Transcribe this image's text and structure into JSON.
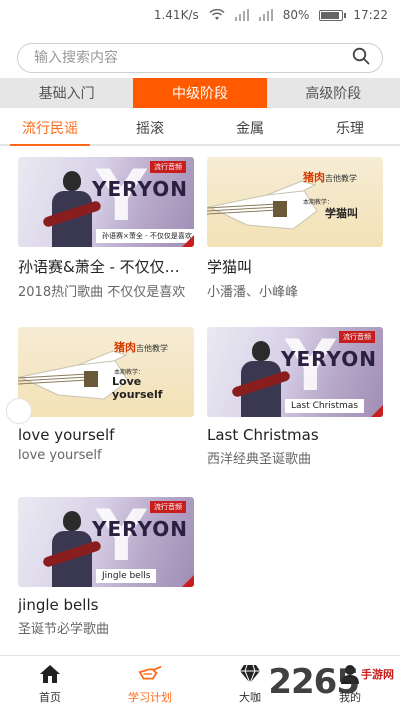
{
  "status_bar": {
    "speed": "1.41K/s",
    "battery": "80%",
    "battery_level": 0.8,
    "time": "17:22"
  },
  "search": {
    "placeholder": "输入搜索内容"
  },
  "level_tabs": [
    {
      "label": "基础入门",
      "active": false
    },
    {
      "label": "中级阶段",
      "active": true
    },
    {
      "label": "高级阶段",
      "active": false
    }
  ],
  "category_tabs": [
    {
      "label": "流行民谣",
      "active": true
    },
    {
      "label": "摇滚",
      "active": false
    },
    {
      "label": "金属",
      "active": false
    },
    {
      "label": "乐理",
      "active": false
    }
  ],
  "cards": [
    {
      "title": "孙语赛&萧全 - 不仅仅是喜欢",
      "subtitle": "2018热门歌曲 不仅仅是喜欢",
      "thumb": {
        "brand": "YERYON",
        "badge": "流行音频",
        "caption": "孙语赛×萧全 - 不仅仅是喜欢"
      }
    },
    {
      "title": "学猫叫",
      "subtitle": "小潘潘、小峰峰",
      "thumb": {
        "series": "猪肉",
        "series_small": "吉他教学",
        "tag": "本期教学：",
        "name": "学猫叫"
      }
    },
    {
      "title": "love yourself",
      "subtitle": "love yourself",
      "thumb": {
        "series": "猪肉",
        "series_small": "吉他教学",
        "tag": "本期教学：",
        "name": "Love yourself"
      }
    },
    {
      "title": "Last Christmas",
      "subtitle": "西洋经典圣诞歌曲",
      "thumb": {
        "brand": "YERYON",
        "badge": "流行音频",
        "caption": "Last Christmas"
      }
    },
    {
      "title": "jingle bells",
      "subtitle": "圣诞节必学歌曲",
      "thumb": {
        "brand": "YERYON",
        "badge": "流行音频",
        "caption": "Jingle bells"
      }
    }
  ],
  "bottom_nav": [
    {
      "label": "首页",
      "icon": "home-icon",
      "active": false
    },
    {
      "label": "学习计划",
      "icon": "guitar-icon",
      "active": true
    },
    {
      "label": "大咖",
      "icon": "diamond-icon",
      "active": false
    },
    {
      "label": "我的",
      "icon": "user-icon",
      "active": false
    }
  ],
  "watermark": {
    "number": "2265",
    "text": "手游网"
  },
  "colors": {
    "accent": "#ff5a00",
    "active_text": "#ff6a1a",
    "badge_red": "#c81e1e"
  }
}
